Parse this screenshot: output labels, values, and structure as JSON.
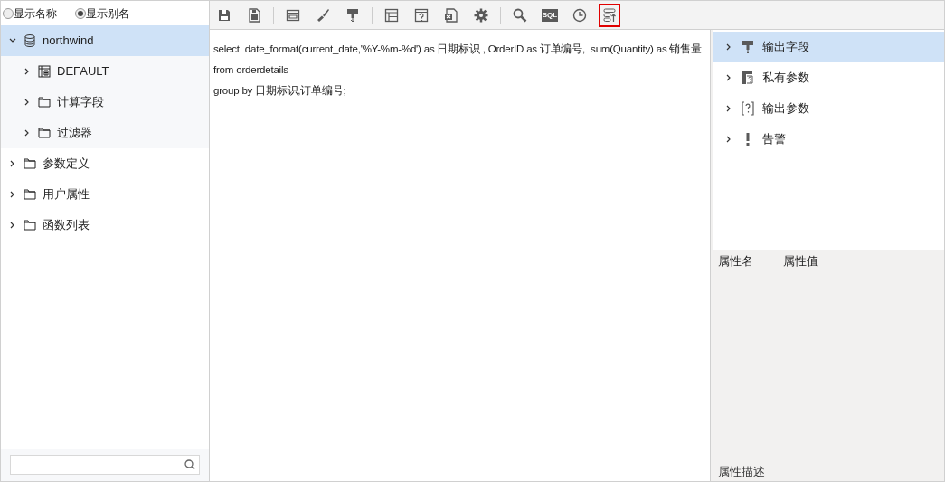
{
  "display_mode": [
    {
      "label": "显示名称",
      "selected": false
    },
    {
      "label": "显示别名",
      "selected": true
    }
  ],
  "tree": [
    {
      "label": "northwind",
      "kind": "database",
      "expanded": true,
      "selected": true,
      "children": [
        {
          "label": "DEFAULT",
          "kind": "table",
          "expanded": false,
          "selected": false
        },
        {
          "label": "计算字段",
          "kind": "folder",
          "expanded": false,
          "selected": false
        },
        {
          "label": "过滤器",
          "kind": "folder",
          "expanded": false,
          "selected": false
        }
      ]
    },
    {
      "label": "参数定义",
      "kind": "folder",
      "expanded": false,
      "selected": false
    },
    {
      "label": "用户属性",
      "kind": "folder",
      "expanded": false,
      "selected": false
    },
    {
      "label": "函数列表",
      "kind": "folder",
      "expanded": false,
      "selected": false
    }
  ],
  "toolbar": [
    {
      "kind": "save",
      "highlighted": false
    },
    {
      "kind": "saveas",
      "highlighted": false
    },
    {
      "kind": "sep"
    },
    {
      "kind": "layout",
      "highlighted": false
    },
    {
      "kind": "brush",
      "highlighted": false
    },
    {
      "kind": "field",
      "highlighted": false
    },
    {
      "kind": "sep"
    },
    {
      "kind": "grid",
      "highlighted": false
    },
    {
      "kind": "param",
      "highlighted": false
    },
    {
      "kind": "excel",
      "highlighted": false
    },
    {
      "kind": "gear",
      "highlighted": false
    },
    {
      "kind": "sep"
    },
    {
      "kind": "search",
      "highlighted": false
    },
    {
      "kind": "sql",
      "label": "SQL",
      "highlighted": false
    },
    {
      "kind": "clock",
      "highlighted": false
    },
    {
      "kind": "sort",
      "highlighted": true
    }
  ],
  "editor": {
    "lines": [
      "select  date_format(current_date,'%Y-%m-%d') as 日期标识 , OrderID as 订单编号,  sum(Quantity) as 销售量 from orderdetails",
      "group by 日期标识,订单编号;"
    ]
  },
  "outline": [
    {
      "label": "输出字段",
      "kind": "field",
      "selected": true
    },
    {
      "label": "私有参数",
      "kind": "private",
      "selected": false
    },
    {
      "label": "输出参数",
      "kind": "param",
      "selected": false
    },
    {
      "label": "告警",
      "kind": "alert",
      "selected": false
    }
  ],
  "properties": {
    "columns": [
      "属性名",
      "属性值"
    ],
    "description_label": "属性描述"
  }
}
